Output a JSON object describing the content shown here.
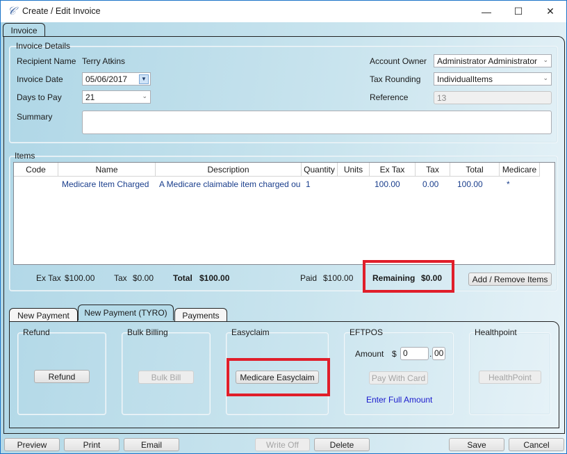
{
  "window": {
    "title": "Create / Edit Invoice",
    "icon": "app-quill-icon",
    "controls": {
      "minimize": "—",
      "maximize": "☐",
      "close": "✕"
    }
  },
  "main_tab": {
    "label": "Invoice"
  },
  "invoice_details": {
    "legend": "Invoice Details",
    "recipient_label": "Recipient Name",
    "recipient_value": "Terry Atkins",
    "invoice_date_label": "Invoice Date",
    "invoice_date_value": "05/06/2017",
    "days_to_pay_label": "Days to Pay",
    "days_to_pay_value": "21",
    "summary_label": "Summary",
    "summary_value": "",
    "account_owner_label": "Account Owner",
    "account_owner_value": "Administrator Administrator",
    "tax_rounding_label": "Tax Rounding",
    "tax_rounding_value": "IndividualItems",
    "reference_label": "Reference",
    "reference_value": "13"
  },
  "items": {
    "legend": "Items",
    "columns": [
      "Code",
      "Name",
      "Description",
      "Quantity",
      "Units",
      "Ex Tax",
      "Tax",
      "Total",
      "Medicare"
    ],
    "rows": [
      {
        "code": "",
        "name": "Medicare Item Charged",
        "description": "A Medicare claimable item charged out",
        "quantity": "1",
        "units": "",
        "ex_tax": "100.00",
        "tax": "0.00",
        "total": "100.00",
        "medicare": "*"
      }
    ],
    "totals": {
      "ex_tax_label": "Ex Tax",
      "ex_tax_value": "$100.00",
      "tax_label": "Tax",
      "tax_value": "$0.00",
      "total_label": "Total",
      "total_value": "$100.00",
      "paid_label": "Paid",
      "paid_value": "$100.00",
      "remaining_label": "Remaining",
      "remaining_value": "$0.00"
    },
    "add_remove_button": "Add / Remove Items"
  },
  "payment_tabs": [
    {
      "label": "New Payment",
      "active": false
    },
    {
      "label": "New Payment (TYRO)",
      "active": true
    },
    {
      "label": "Payments",
      "active": false
    }
  ],
  "payment_sections": {
    "refund": {
      "legend": "Refund",
      "button": "Refund"
    },
    "bulk_billing": {
      "legend": "Bulk Billing",
      "button": "Bulk Bill"
    },
    "easyclaim": {
      "legend": "Easyclaim",
      "button": "Medicare Easyclaim"
    },
    "eftpos": {
      "legend": "EFTPOS",
      "amount_label": "Amount",
      "currency": "$",
      "dollars_value": "0",
      "decimal_sep": ".",
      "cents_value": "00",
      "pay_button": "Pay With Card",
      "full_amount_link": "Enter Full Amount"
    },
    "healthpoint": {
      "legend": "Healthpoint",
      "button": "HealthPoint"
    }
  },
  "footer": {
    "preview": "Preview",
    "print": "Print",
    "email": "Email",
    "write_off": "Write Off",
    "delete": "Delete",
    "save": "Save",
    "cancel": "Cancel"
  },
  "colors": {
    "highlight": "#e01e2a",
    "link": "#1a1acd",
    "grid_text": "#1a3e8c"
  }
}
